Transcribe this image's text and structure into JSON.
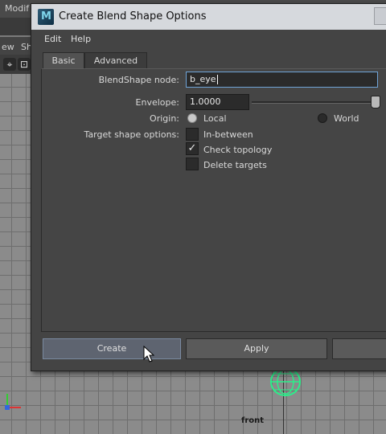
{
  "background": {
    "topbar_menu": "Modif",
    "panel_menu": [
      "ew",
      "Sh"
    ],
    "camera_label": "front"
  },
  "dialog": {
    "title": "Create Blend Shape Options",
    "menu": {
      "edit": "Edit",
      "help": "Help"
    },
    "tabs": [
      {
        "label": "Basic",
        "active": true
      },
      {
        "label": "Advanced",
        "active": false
      }
    ],
    "form": {
      "blendshape_node_label": "BlendShape node:",
      "blendshape_node_value": "b_eye",
      "envelope_label": "Envelope:",
      "envelope_value": "1.0000",
      "envelope_slider_level": 1.0,
      "origin_label": "Origin:",
      "origin_local": "Local",
      "origin_world": "World",
      "origin_selected": "Local",
      "target_options_label": "Target shape options:",
      "in_between": {
        "label": "In-between",
        "checked": false
      },
      "check_topology": {
        "label": "Check topology",
        "checked": true
      },
      "delete_targets": {
        "label": "Delete targets",
        "checked": false
      }
    },
    "buttons": {
      "create": "Create",
      "apply": "Apply",
      "close": ""
    }
  }
}
